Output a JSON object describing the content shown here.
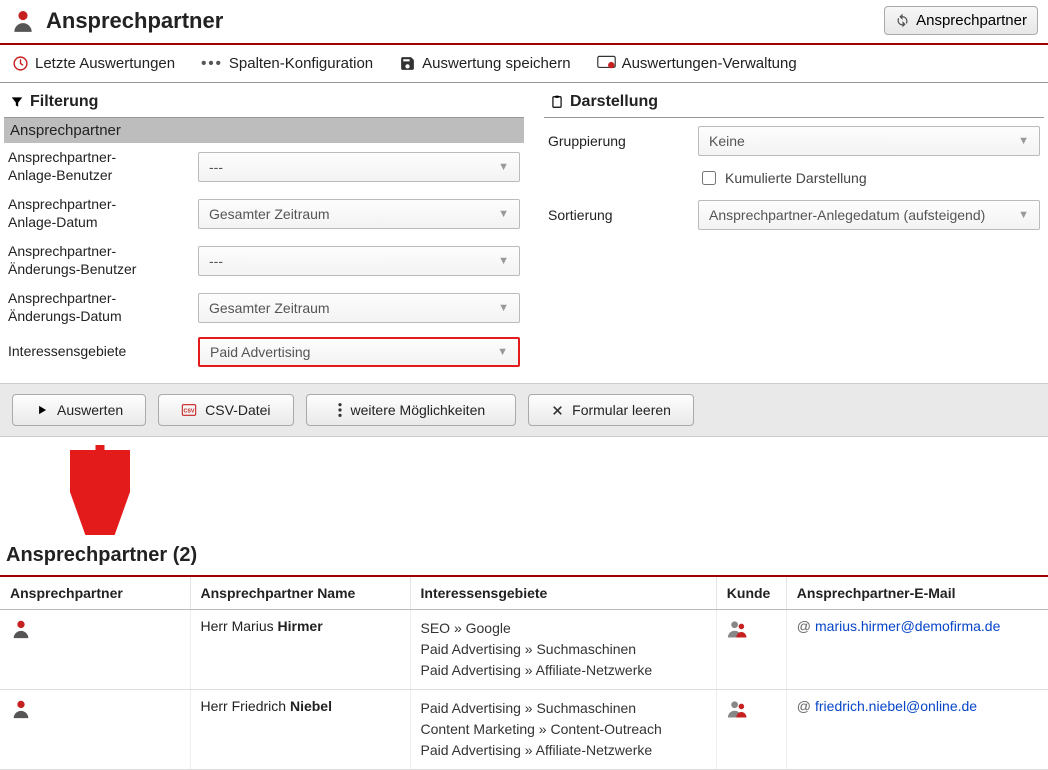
{
  "header": {
    "title": "Ansprechpartner",
    "refresh_label": "Ansprechpartner"
  },
  "toolbar": {
    "recent": "Letzte Auswertungen",
    "columns": "Spalten-Konfiguration",
    "save": "Auswertung speichern",
    "manage": "Auswertungen-Verwaltung"
  },
  "filter": {
    "section_title": "Filterung",
    "group_label": "Ansprechpartner",
    "rows": [
      {
        "label": "Ansprechpartner-Anlage-Benutzer",
        "value": "---"
      },
      {
        "label": "Ansprechpartner-Anlage-Datum",
        "value": "Gesamter Zeitraum"
      },
      {
        "label": "Ansprechpartner-Änderungs-Benutzer",
        "value": "---"
      },
      {
        "label": "Ansprechpartner-Änderungs-Datum",
        "value": "Gesamter Zeitraum"
      },
      {
        "label": "Interessensgebiete",
        "value": "Paid Advertising",
        "highlight": true
      }
    ]
  },
  "presentation": {
    "section_title": "Darstellung",
    "grouping_label": "Gruppierung",
    "grouping_value": "Keine",
    "cumulated_label": "Kumulierte Darstellung",
    "sorting_label": "Sortierung",
    "sorting_value": "Ansprechpartner-Anlegedatum (aufsteigend)"
  },
  "actions": {
    "evaluate": "Auswerten",
    "csv": "CSV-Datei",
    "more": "weitere Möglichkeiten",
    "clear": "Formular leeren"
  },
  "results": {
    "title": "Ansprechpartner (2)",
    "columns": [
      "Ansprechpartner",
      "Ansprechpartner Name",
      "Interessensgebiete",
      "Kunde",
      "Ansprechpartner-E-Mail"
    ],
    "rows": [
      {
        "salutation": "Herr",
        "first": "Marius",
        "last": "Hirmer",
        "interests": [
          "SEO » Google",
          "Paid Advertising » Suchmaschinen",
          "Paid Advertising » Affiliate-Netzwerke"
        ],
        "email": "marius.hirmer@demofirma.de"
      },
      {
        "salutation": "Herr",
        "first": "Friedrich",
        "last": "Niebel",
        "interests": [
          "Paid Advertising » Suchmaschinen",
          "Content Marketing » Content-Outreach",
          "Paid Advertising » Affiliate-Netzwerke"
        ],
        "email": "friedrich.niebel@online.de"
      }
    ]
  }
}
